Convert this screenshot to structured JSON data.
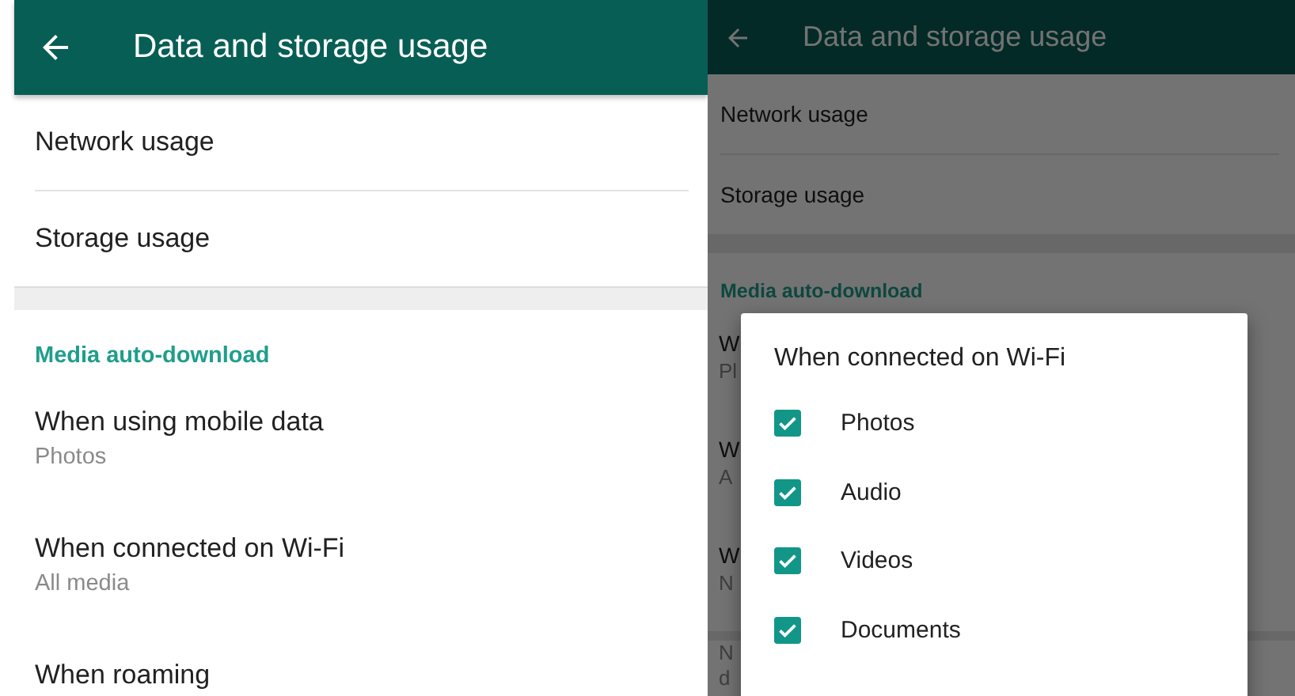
{
  "left_screen": {
    "title": "Data and storage usage",
    "general_items": [
      {
        "title": "Network usage"
      },
      {
        "title": "Storage usage"
      }
    ],
    "section_header": "Media auto-download",
    "auto_download_items": [
      {
        "title": "When using mobile data",
        "subtitle": "Photos"
      },
      {
        "title": "When connected on Wi-Fi",
        "subtitle": "All media"
      },
      {
        "title": "When roaming"
      }
    ]
  },
  "right_screen": {
    "title": "Data and storage usage",
    "general_items": [
      {
        "title": "Network usage"
      },
      {
        "title": "Storage usage"
      }
    ],
    "section_header": "Media auto-download",
    "obscured_items": [
      {
        "title": "W",
        "subtitle": "Pl"
      },
      {
        "title": "W",
        "subtitle": "A"
      },
      {
        "title": "W",
        "subtitle": "N"
      }
    ],
    "obscured_footer": [
      "N",
      "d"
    ],
    "dialog": {
      "title": "When connected on Wi-Fi",
      "options": [
        {
          "label": "Photos",
          "checked": true
        },
        {
          "label": "Audio",
          "checked": true
        },
        {
          "label": "Videos",
          "checked": true
        },
        {
          "label": "Documents",
          "checked": true
        }
      ]
    }
  }
}
